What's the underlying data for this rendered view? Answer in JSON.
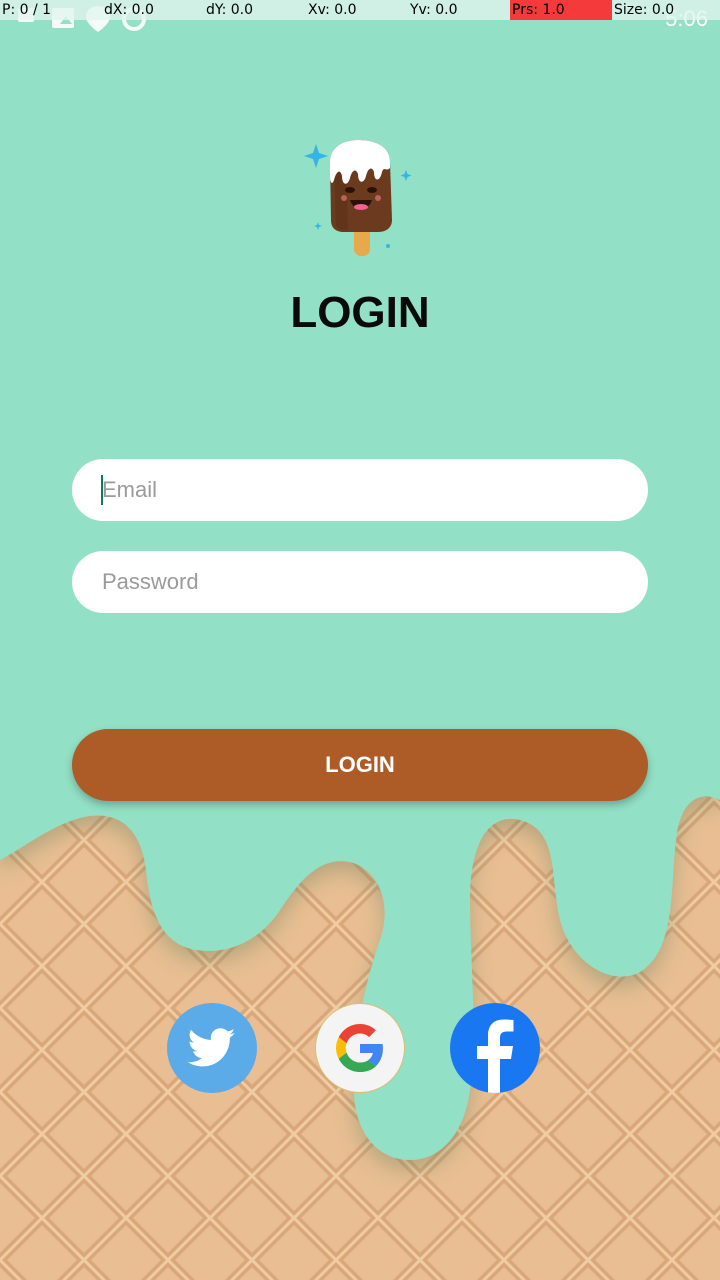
{
  "status_overlay": {
    "pointer": "P: 0 / 1",
    "dx": "dX: 0.0",
    "dy": "dY: 0.0",
    "xv": "Xv: 0.0",
    "yv": "Yv: 0.0",
    "prs": "Prs: 1.0",
    "size": "Size: 0.0",
    "prs_color": "#f43a3a"
  },
  "status_bar": {
    "time": "5:06"
  },
  "header": {
    "title": "LOGIN",
    "logo_icon": "ice-cream-bar-icon"
  },
  "form": {
    "email_placeholder": "Email",
    "email_value": "",
    "password_placeholder": "Password",
    "password_value": "",
    "login_label": "LOGIN"
  },
  "social": [
    {
      "name": "twitter",
      "icon": "twitter-bird-icon",
      "color": "#5aabe8"
    },
    {
      "name": "google",
      "icon": "google-g-icon",
      "color": "#f4f4f4"
    },
    {
      "name": "facebook",
      "icon": "facebook-f-icon",
      "color": "#1a77f2"
    }
  ],
  "colors": {
    "background": "#92e0c5",
    "button": "#ad5c27",
    "waffle": "#e8bf92"
  }
}
